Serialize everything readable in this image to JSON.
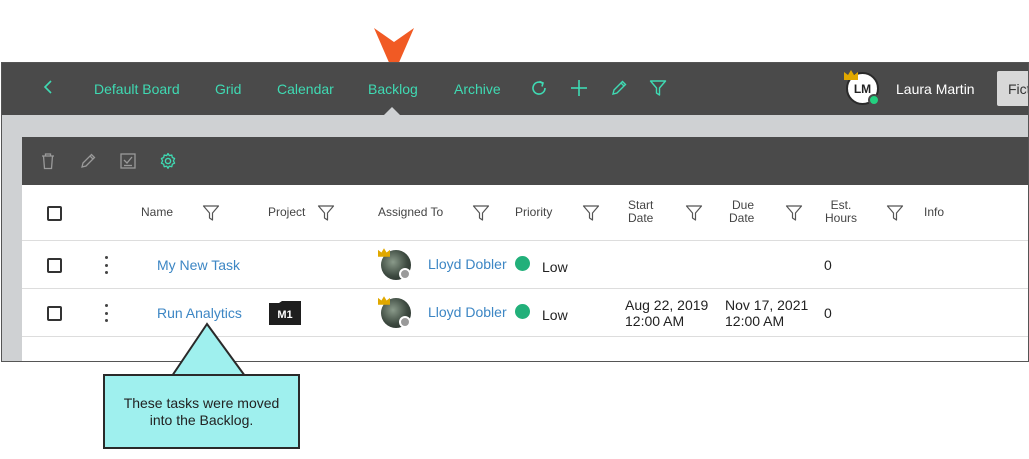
{
  "topbar": {
    "nav_items": [
      {
        "label": "Default Board"
      },
      {
        "label": "Grid"
      },
      {
        "label": "Calendar"
      },
      {
        "label": "Backlog",
        "active": true
      },
      {
        "label": "Archive"
      }
    ],
    "tool_icons": [
      "refresh-icon",
      "plus-icon",
      "pencil-icon",
      "filter-icon"
    ],
    "user": {
      "initials": "LM",
      "name": "Laura Martin"
    },
    "board_select_value": "Fict"
  },
  "panel": {
    "toolbar_icons": [
      "trash-icon",
      "pencil-icon",
      "checklist-icon",
      "gear-icon"
    ],
    "columns": {
      "name": "Name",
      "project": "Project",
      "assigned_to": "Assigned To",
      "priority": "Priority",
      "start_date_1": "Start",
      "start_date_2": "Date",
      "due_date_1": "Due",
      "due_date_2": "Date",
      "est_hours_1": "Est.",
      "est_hours_2": "Hours",
      "info": "Info"
    },
    "rows": [
      {
        "name": "My New Task",
        "project": "",
        "assignee": "Lloyd Dobler",
        "priority": "Low",
        "start_date": "",
        "start_time": "",
        "due_date": "",
        "due_time": "",
        "est_hours": "0"
      },
      {
        "name": "Run Analytics",
        "project": "M1",
        "assignee": "Lloyd Dobler",
        "priority": "Low",
        "start_date": "Aug 22, 2019",
        "start_time": "12:00 AM",
        "due_date": "Nov 17, 2021",
        "due_time": "12:00 AM",
        "est_hours": "0"
      }
    ]
  },
  "callout": {
    "text": "These tasks were moved into the Backlog."
  },
  "colors": {
    "accent": "#3fdab3",
    "dark_bar": "#4a4a4a",
    "link": "#3c86c4",
    "priority_low": "#22b07a",
    "pointer_arrow": "#f15a24",
    "callout_bg": "#9ff0ee"
  }
}
